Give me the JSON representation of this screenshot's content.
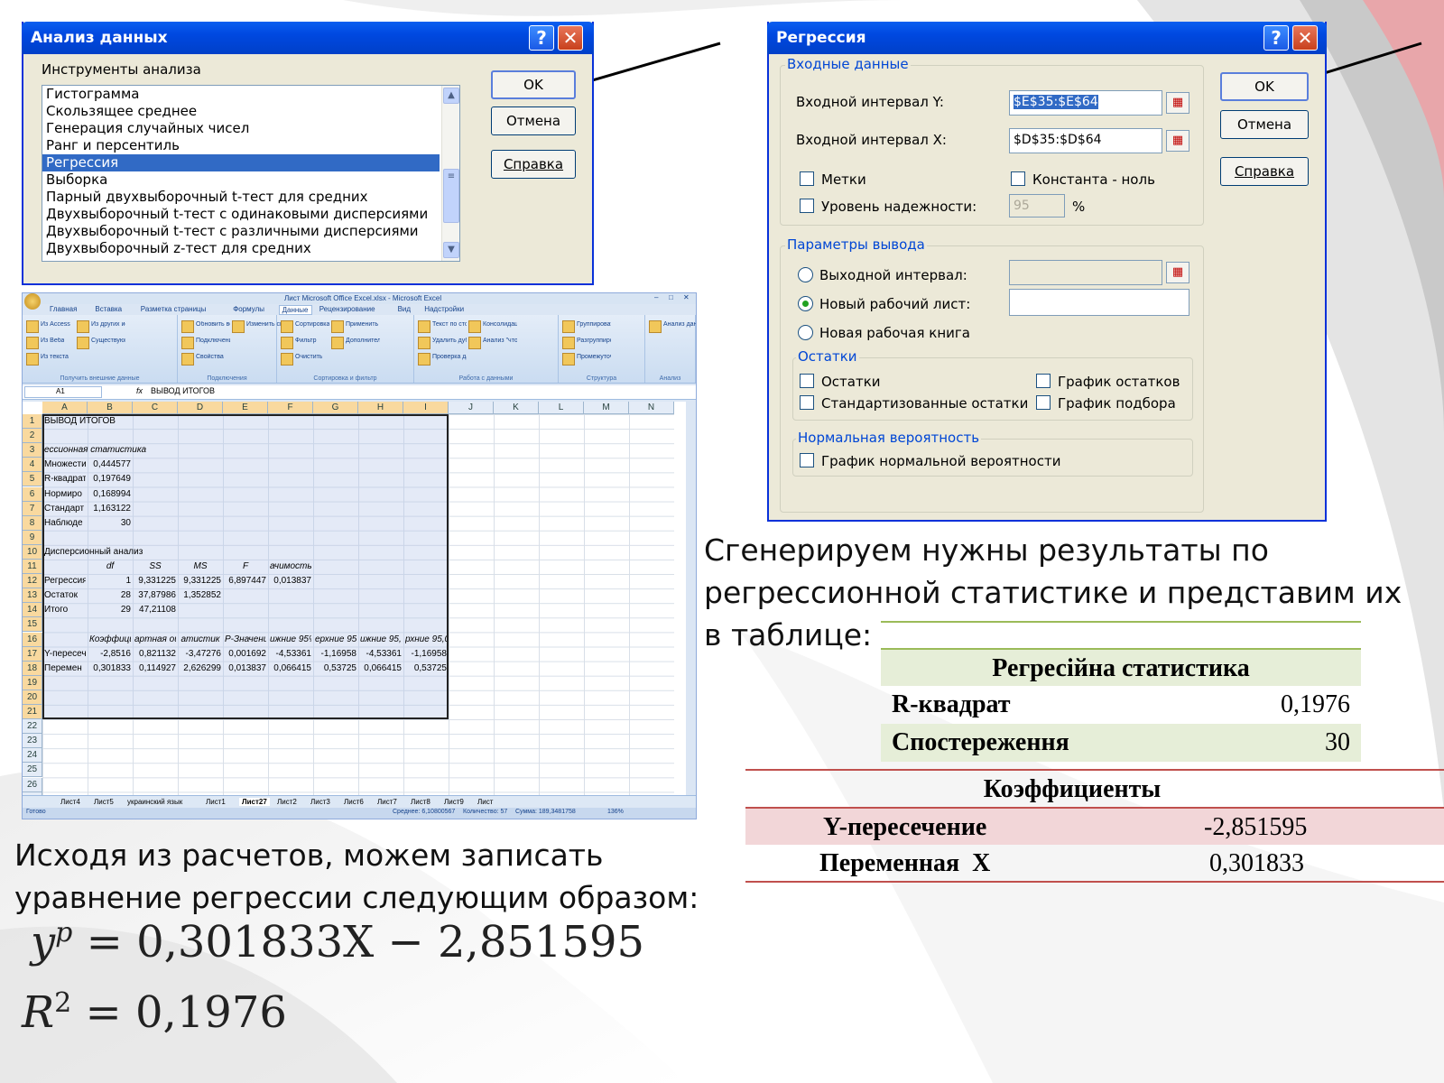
{
  "dialog_analysis": {
    "title": "Анализ данных",
    "tools_label": "Инструменты анализа",
    "items": [
      "Гистограмма",
      "Скользящее среднее",
      "Генерация случайных чисел",
      "Ранг и персентиль",
      "Регрессия",
      "Выборка",
      "Парный двухвыборочный t-тест для средних",
      "Двухвыборочный t-тест с одинаковыми дисперсиями",
      "Двухвыборочный t-тест с различными дисперсиями",
      "Двухвыборочный z-тест для средних"
    ],
    "selected_index": 4,
    "ok": "OK",
    "cancel": "Отмена",
    "help": "Справка",
    "help_glyph": "?",
    "close_glyph": "✕"
  },
  "dialog_regression": {
    "title": "Регрессия",
    "input_group": "Входные данные",
    "input_y_label": "Входной интервал Y:",
    "input_y_value": "$E$35:$E$64",
    "input_x_label": "Входной интервал X:",
    "input_x_value": "$D$35:$D$64",
    "labels_check": "Метки",
    "const_zero_check": "Константа - ноль",
    "confidence_check": "Уровень надежности:",
    "confidence_value": "95",
    "percent": "%",
    "output_group": "Параметры вывода",
    "output_range": "Выходной интервал:",
    "new_sheet": "Новый рабочий лист:",
    "new_book": "Новая рабочая книга",
    "residuals_group": "Остатки",
    "residuals": "Остатки",
    "std_residuals": "Стандартизованные остатки",
    "residual_plot": "График остатков",
    "fit_plot": "График подбора",
    "normal_group": "Нормальная вероятность",
    "normal_plot": "График нормальной вероятности",
    "ok": "OK",
    "cancel": "Отмена",
    "help": "Справка",
    "help_glyph": "?",
    "close_glyph": "✕"
  },
  "excel": {
    "window_title": "Лист Microsoft Office Excel.xlsx - Microsoft Excel",
    "tabs": [
      "Главная",
      "Вставка",
      "Разметка страницы",
      "Формулы",
      "Данные",
      "Рецензирование",
      "Вид",
      "Надстройки"
    ],
    "ribbon_groups": [
      {
        "caption": "Получить внешние данные",
        "items": [
          "Из Access",
          "Из Веба",
          "Из текста",
          "Из других источников",
          "Существующие подключения"
        ]
      },
      {
        "caption": "Подключения",
        "items": [
          "Обновить все",
          "Подключения",
          "Свойства",
          "Изменить связи"
        ]
      },
      {
        "caption": "Сортировка и фильтр",
        "items": [
          "Сортировка",
          "Фильтр",
          "Очистить",
          "Применить повторно",
          "Дополнительно"
        ]
      },
      {
        "caption": "Работа с данными",
        "items": [
          "Текст по столбцам",
          "Удалить дубликаты",
          "Проверка данных",
          "Консолидация",
          "Анализ \"что-если\""
        ]
      },
      {
        "caption": "Структура",
        "items": [
          "Группировать",
          "Разгруппировать",
          "Промежуточные итоги"
        ]
      },
      {
        "caption": "Анализ",
        "items": [
          "Анализ данных"
        ]
      }
    ],
    "name_box": "A1",
    "fx": "fx",
    "formula_value": "ВЫВОД ИТОГОВ",
    "columns": [
      "A",
      "B",
      "C",
      "D",
      "E",
      "F",
      "G",
      "H",
      "I",
      "J",
      "K",
      "L",
      "M",
      "N"
    ],
    "rows": [
      [
        "ВЫВОД ИТОГОВ"
      ],
      [],
      [
        "ессионная статистика"
      ],
      [
        "Множести",
        "0,444577"
      ],
      [
        "R-квадрат",
        "0,197649"
      ],
      [
        "Нормиро",
        "0,168994"
      ],
      [
        "Стандарт",
        "1,163122"
      ],
      [
        "Наблюде",
        "30"
      ],
      [],
      [
        "Дисперсионный анализ"
      ],
      [
        "",
        "df",
        "SS",
        "MS",
        "F",
        "ачимость F"
      ],
      [
        "Регрессия",
        "1",
        "9,331225",
        "9,331225",
        "6,897447",
        "0,013837"
      ],
      [
        "Остаток",
        "28",
        "37,87986",
        "1,352852"
      ],
      [
        "Итого",
        "29",
        "47,21108"
      ],
      [],
      [
        "",
        "Коэффициент",
        "артная ошиб",
        "атистик",
        "P-Значение",
        "ижние 95%",
        "ерхние 95%",
        "ижние 95,0%",
        "рхние 95,0%"
      ],
      [
        "Y-пересеч",
        "-2,8516",
        "0,821132",
        "-3,47276",
        "0,001692",
        "-4,53361",
        "-1,16958",
        "-4,53361",
        "-1,16958"
      ],
      [
        "Перемен",
        "0,301833",
        "0,114927",
        "2,626299",
        "0,013837",
        "0,066415",
        "0,53725",
        "0,066415",
        "0,53725"
      ],
      [],
      [],
      [],
      [],
      [],
      [],
      [],
      [],
      [],
      []
    ],
    "sheet_tabs": [
      "Лист4",
      "Лист5",
      "украинский язык",
      "Лист1",
      "Лист27",
      "Лист2",
      "Лист3",
      "Лист6",
      "Лист7",
      "Лист8",
      "Лист9",
      "Лист"
    ],
    "active_sheet": "Лист27",
    "status_ready": "Готово",
    "status_avg": "Среднее: 6,10800567",
    "status_count": "Количество: 57",
    "status_sum": "Сумма: 189,3481758",
    "zoom": "136%"
  },
  "text_generate": [
    "Сгенерируем нужны результаты по",
    "регрессионной статистике и представим их",
    "в таблице:"
  ],
  "text_conclusion": [
    "Исходя из расчетов, можем записать",
    "уравнение регрессии следующим образом:"
  ],
  "equation_1": {
    "lhs": "y",
    "sup": "p",
    "rhs": " = 0,301833X − 2,851595"
  },
  "equation_2": {
    "lhs": "R",
    "sup": "2",
    "rhs": " = 0,1976"
  },
  "table_stats": {
    "header": "Регресійна статистика",
    "rows": [
      {
        "label": "R-квадрат",
        "value": "0,1976"
      },
      {
        "label": "Спостереження",
        "value": "30"
      }
    ]
  },
  "table_coef": {
    "header": "Коэффициенты",
    "rows": [
      {
        "label": "Y-пересечение",
        "value": "-2,851595"
      },
      {
        "label": "Переменная  X",
        "value": "0,301833"
      }
    ]
  },
  "colors": {
    "xp_title": "#0048e0",
    "xp_face": "#ece9d8",
    "selection": "#316ac5",
    "table_green": "#e6eed8",
    "table_pink": "#f2d6d8",
    "table_line_red": "#c0504d"
  }
}
